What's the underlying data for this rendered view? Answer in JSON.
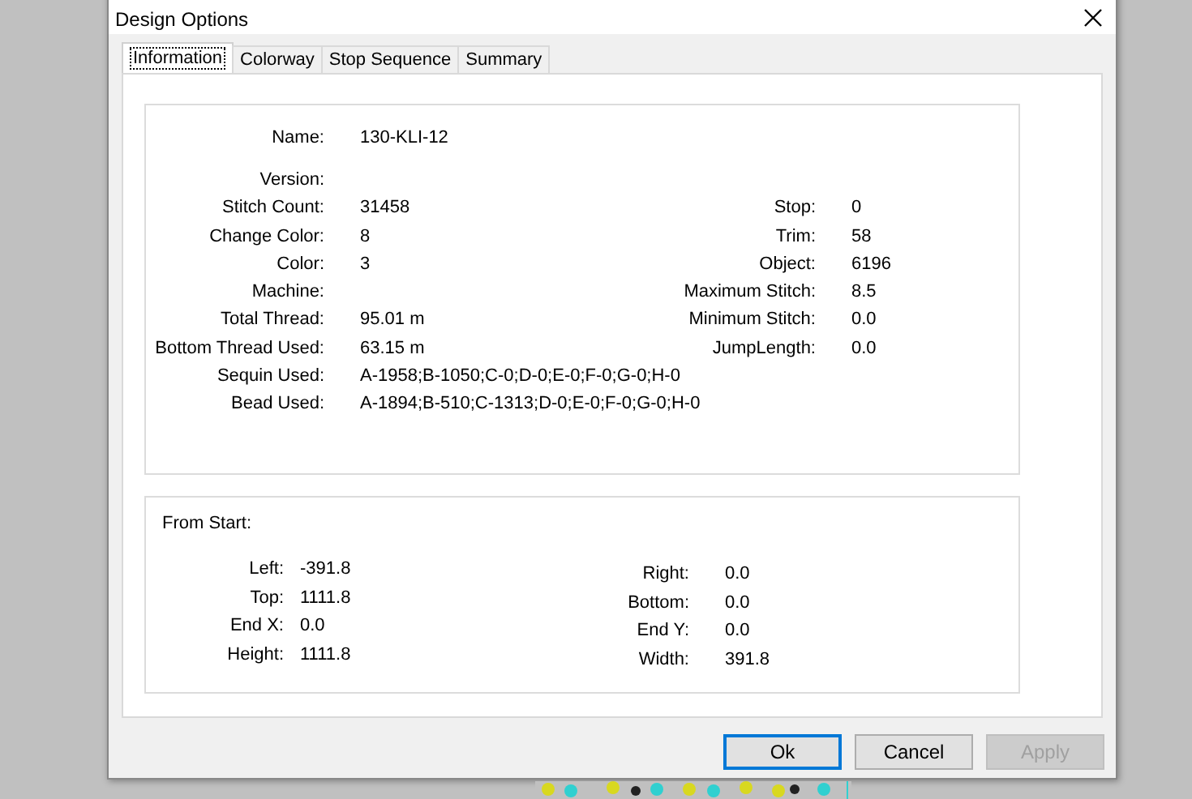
{
  "window": {
    "title": "Design Options"
  },
  "tabs": [
    {
      "label": "Information",
      "selected": true
    },
    {
      "label": "Colorway",
      "selected": false
    },
    {
      "label": "Stop Sequence",
      "selected": false
    },
    {
      "label": "Summary",
      "selected": false
    }
  ],
  "information": {
    "rows": [
      {
        "label": "Name:",
        "value": "130-KLI-12"
      },
      {
        "label": "Version:"
      },
      {
        "label": "Stitch Count:",
        "value": "31458",
        "right_label": "Stop:",
        "right_value": "0"
      },
      {
        "label": "Change Color:",
        "value": "8",
        "right_label": "Trim:",
        "right_value": "58"
      },
      {
        "label": "Color:",
        "value": "3",
        "right_label": "Object:",
        "right_value": "6196"
      },
      {
        "label": "Machine:",
        "right_label": "Maximum Stitch:",
        "right_value": "8.5"
      },
      {
        "label": "Total Thread:",
        "value": "95.01 m",
        "right_label": "Minimum Stitch:",
        "right_value": "0.0"
      },
      {
        "label": "Bottom Thread Used:",
        "value": "63.15 m",
        "right_label": "JumpLength:",
        "right_value": "0.0"
      },
      {
        "label": "Sequin Used:",
        "value": "A-1958;B-1050;C-0;D-0;E-0;F-0;G-0;H-0"
      },
      {
        "label": "Bead Used:",
        "value": "A-1894;B-510;C-1313;D-0;E-0;F-0;G-0;H-0"
      }
    ]
  },
  "from_start": {
    "title": "From Start:",
    "left": [
      {
        "label": "Left:",
        "value": "-391.8"
      },
      {
        "label": "Top:",
        "value": "1111.8"
      },
      {
        "label": "End X:",
        "value": "0.0"
      },
      {
        "label": "Height:",
        "value": "1111.8"
      }
    ],
    "right": [
      {
        "label": "Right:",
        "value": "0.0"
      },
      {
        "label": "Bottom:",
        "value": "0.0"
      },
      {
        "label": "End Y:",
        "value": "0.0"
      },
      {
        "label": "Width:",
        "value": "391.8"
      }
    ]
  },
  "buttons": [
    {
      "label": "Ok",
      "kind": "default",
      "disabled": false
    },
    {
      "label": "Cancel",
      "kind": "normal",
      "disabled": false
    },
    {
      "label": "Apply",
      "kind": "normal",
      "disabled": true
    }
  ]
}
